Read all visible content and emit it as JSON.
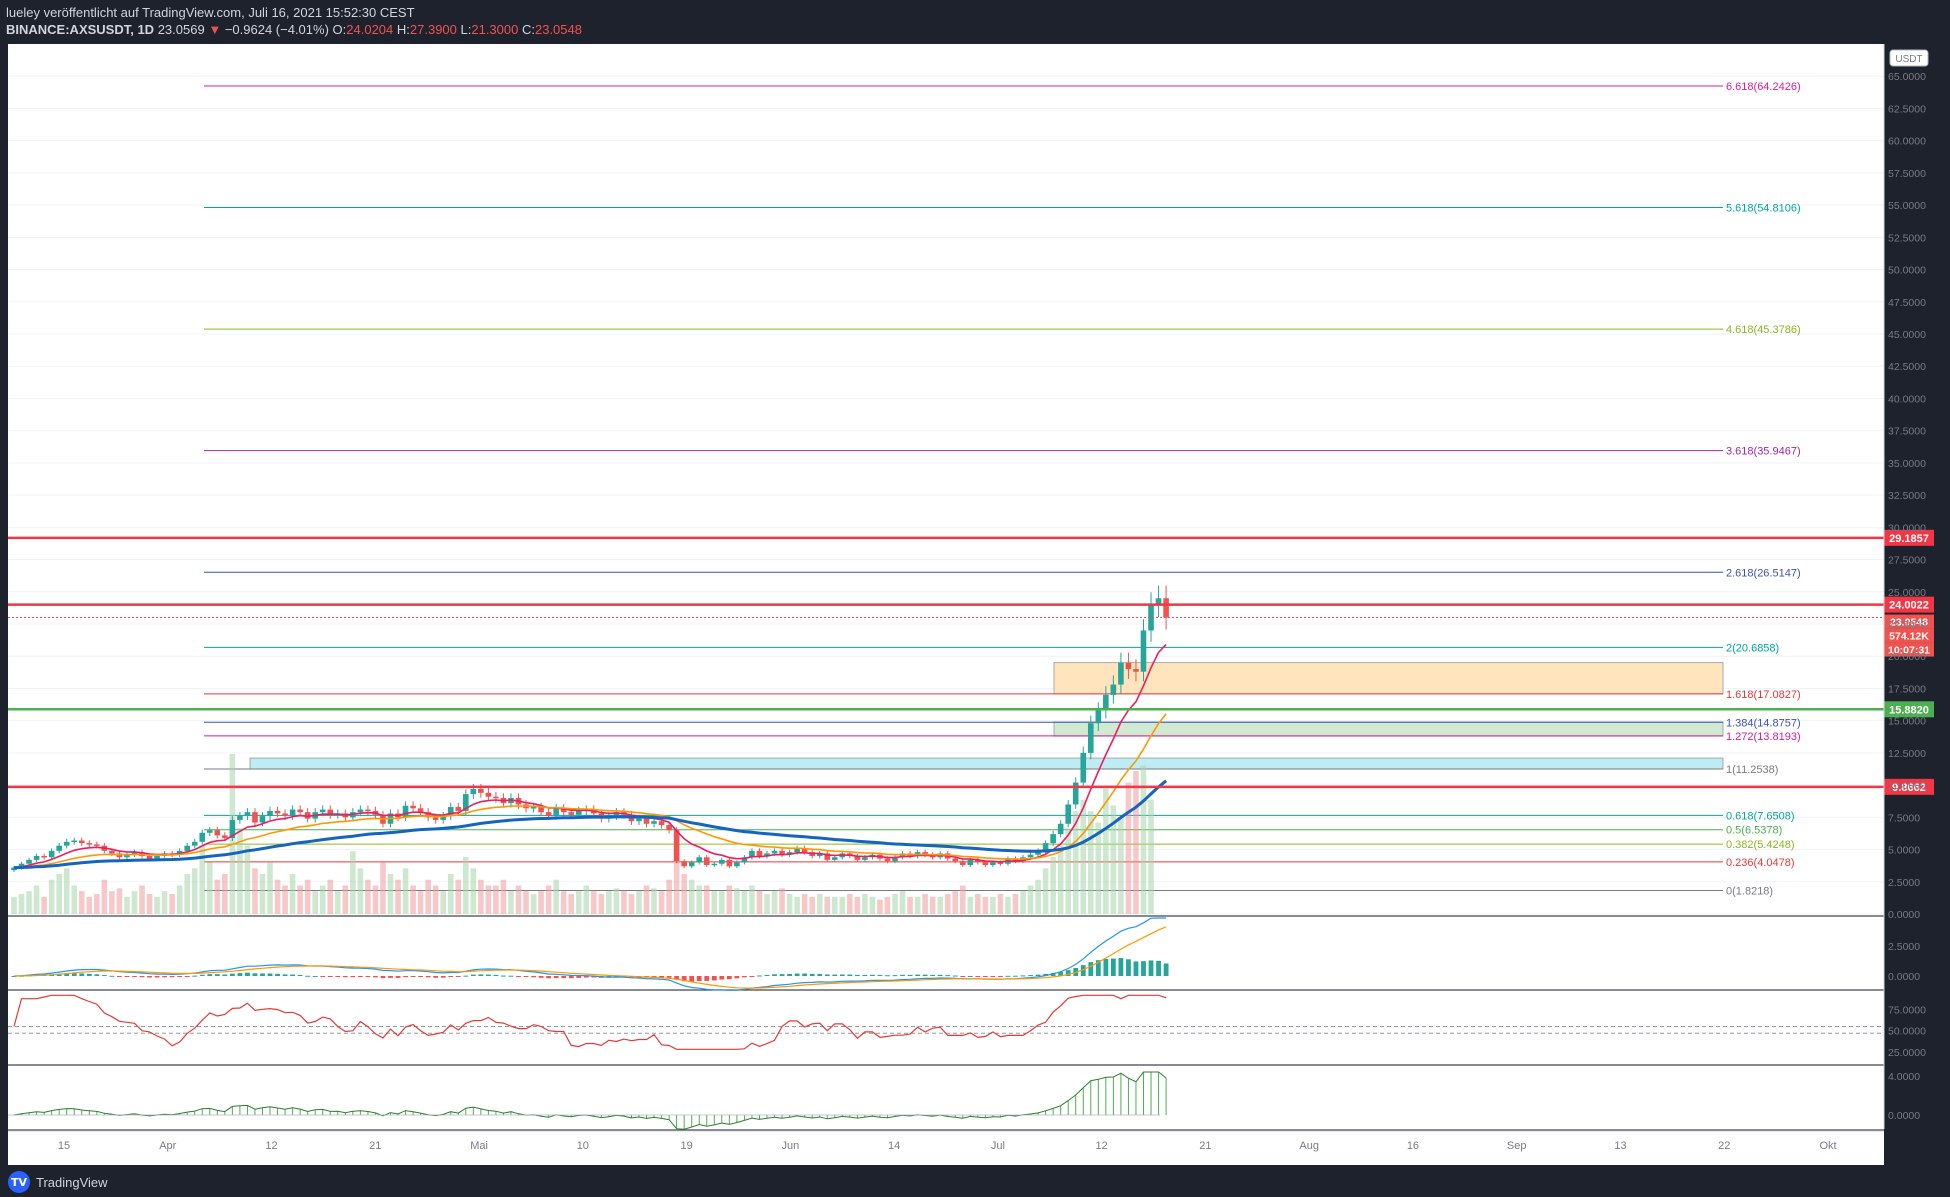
{
  "header": {
    "publisher": "lueley veröffentlicht auf TradingView.com, Juli 16, 2021 15:52:30 CEST",
    "symbol": "BINANCE:AXSUSDT, 1D",
    "last": "23.0569",
    "change": "−0.9624 (−4.01%)",
    "o_label": "O:",
    "o_value": "24.0204",
    "h_label": "H:",
    "h_value": "27.3900",
    "l_label": "L:",
    "l_value": "21.3000",
    "c_label": "C:",
    "c_value": "23.0548"
  },
  "footer": {
    "brand": "TradingView",
    "logo_text": "TV"
  },
  "colors": {
    "background": "#ffffff",
    "up": "#26a69a",
    "down": "#ef5350",
    "resistance": "#f23645",
    "support": "#4caf50"
  },
  "chart_data": {
    "type": "line",
    "price_unit_badge": "USDT",
    "x_tick_labels": [
      "15",
      "Apr",
      "12",
      "21",
      "Mai",
      "10",
      "19",
      "Jun",
      "14",
      "Jul",
      "12",
      "21",
      "Aug",
      "16",
      "Sep",
      "13",
      "22",
      "Okt"
    ],
    "y_ticks": [
      "65.0000",
      "62.5000",
      "60.0000",
      "57.5000",
      "55.0000",
      "52.5000",
      "50.0000",
      "47.5000",
      "45.0000",
      "42.5000",
      "40.0000",
      "37.5000",
      "35.0000",
      "32.5000",
      "30.0000",
      "27.5000",
      "25.0000",
      "22.5000",
      "20.0000",
      "17.5000",
      "15.0000",
      "12.5000",
      "10.0000",
      "7.5000",
      "5.0000",
      "2.5000",
      "0.0000"
    ],
    "ylim": [
      0,
      67.5
    ],
    "fib_levels": [
      {
        "label": "6.618(64.2426)",
        "value": 64.2426,
        "color": "#d81b9c"
      },
      {
        "label": "5.618(54.8106)",
        "value": 54.8106,
        "color": "#00a79d"
      },
      {
        "label": "4.618(45.3786)",
        "value": 45.3786,
        "color": "#8bb71e"
      },
      {
        "label": "3.618(35.9467)",
        "value": 35.9467,
        "color": "#9c27b0"
      },
      {
        "label": "2.618(26.5147)",
        "value": 26.5147,
        "color": "#3f51b5"
      },
      {
        "label": "2(20.6858)",
        "value": 20.6858,
        "color": "#00a79d"
      },
      {
        "label": "1.618(17.0827)",
        "value": 17.0827,
        "color": "#e53935"
      },
      {
        "label": "1.384(14.8757)",
        "value": 14.8757,
        "color": "#3f51b5"
      },
      {
        "label": "1.272(13.8193)",
        "value": 13.8193,
        "color": "#d81b9c"
      },
      {
        "label": "1(11.2538)",
        "value": 11.2538,
        "color": "#787b86"
      },
      {
        "label": "0.618(7.6508)",
        "value": 7.6508,
        "color": "#00a79d"
      },
      {
        "label": "0.5(6.5378)",
        "value": 6.5378,
        "color": "#4caf50"
      },
      {
        "label": "0.382(5.4248)",
        "value": 5.4248,
        "color": "#8bb71e"
      },
      {
        "label": "0.236(4.0478)",
        "value": 4.0478,
        "color": "#e53935"
      },
      {
        "label": "0(1.8218)",
        "value": 1.8218,
        "color": "#787b86"
      }
    ],
    "horizontal_lines": [
      {
        "label": "29.1857",
        "value": 29.1857,
        "color": "#f23645"
      },
      {
        "label": "24.0022",
        "value": 24.0022,
        "color": "#f23645"
      },
      {
        "label": "15.8820",
        "value": 15.882,
        "color": "#4caf50"
      },
      {
        "label": "9.8662",
        "value": 9.8662,
        "color": "#f23645"
      }
    ],
    "price_tags": [
      {
        "text": "23.0548",
        "color": "#ef5350"
      },
      {
        "text": "574.12K",
        "color": "#ef5350"
      },
      {
        "text": "10:07:31",
        "color": "#ef5350"
      }
    ],
    "zones": [
      {
        "from": 17.08,
        "to": 19.5,
        "color": "#ffe0b2"
      },
      {
        "from": 13.8,
        "to": 14.9,
        "color": "#c8e6c9"
      },
      {
        "from": 11.25,
        "to": 12.1,
        "color": "#b2ebf2"
      }
    ],
    "closes": [
      3.6,
      3.9,
      4.2,
      4.5,
      4.4,
      4.9,
      5.3,
      5.6,
      5.7,
      5.5,
      5.4,
      5.3,
      4.9,
      4.7,
      4.4,
      4.6,
      4.8,
      4.5,
      4.3,
      4.5,
      4.7,
      4.6,
      4.9,
      5.3,
      5.6,
      6.3,
      6.5,
      6.1,
      5.9,
      7.3,
      7.6,
      7.9,
      7.1,
      7.6,
      8.0,
      7.8,
      7.6,
      8.1,
      7.9,
      7.4,
      7.9,
      8.1,
      7.7,
      7.8,
      7.5,
      7.9,
      8.1,
      8.0,
      7.7,
      7.0,
      7.8,
      7.5,
      8.4,
      8.2,
      7.9,
      7.5,
      7.3,
      7.6,
      8.3,
      8.0,
      9.3,
      9.7,
      9.4,
      9.1,
      9.0,
      8.6,
      9.0,
      8.5,
      8.2,
      8.3,
      7.9,
      7.6,
      8.2,
      7.9,
      7.7,
      8.0,
      8.1,
      7.8,
      7.4,
      7.6,
      7.9,
      7.7,
      7.2,
      7.4,
      7.0,
      7.2,
      6.9,
      6.5,
      4.1,
      3.7,
      4.0,
      4.4,
      3.8,
      3.9,
      4.2,
      3.7,
      4.0,
      4.4,
      4.9,
      4.5,
      4.7,
      4.9,
      4.6,
      4.8,
      5.1,
      4.8,
      4.5,
      4.7,
      4.2,
      4.4,
      4.7,
      4.5,
      4.2,
      4.4,
      4.6,
      4.3,
      4.1,
      4.4,
      4.7,
      4.5,
      4.8,
      4.6,
      4.4,
      4.7,
      4.3,
      4.1,
      3.8,
      4.2,
      4.0,
      3.8,
      4.0,
      3.9,
      4.3,
      4.1,
      4.4,
      4.6,
      4.9,
      5.5,
      6.2,
      7.0,
      8.5,
      10.2,
      12.5,
      14.8,
      15.8,
      17.0,
      17.8,
      19.5,
      19.0,
      18.8,
      22.0,
      24.0,
      24.5,
      23.0
    ],
    "volumes": [
      0.3,
      0.35,
      0.4,
      0.5,
      0.3,
      0.6,
      0.7,
      0.8,
      0.5,
      0.4,
      0.3,
      0.35,
      0.6,
      0.4,
      0.45,
      0.3,
      0.4,
      0.5,
      0.35,
      0.3,
      0.4,
      0.35,
      0.5,
      0.7,
      0.8,
      1.2,
      0.9,
      0.6,
      0.7,
      2.8,
      1.5,
      1.2,
      0.8,
      0.7,
      0.9,
      0.6,
      0.5,
      0.7,
      0.5,
      0.6,
      0.4,
      0.5,
      0.6,
      0.4,
      0.5,
      1.1,
      0.8,
      0.6,
      0.5,
      0.9,
      0.7,
      0.6,
      0.8,
      0.5,
      0.4,
      0.6,
      0.5,
      0.4,
      0.7,
      0.6,
      1.0,
      0.8,
      0.6,
      0.5,
      0.5,
      0.6,
      0.4,
      0.5,
      0.4,
      0.35,
      0.4,
      0.5,
      0.6,
      0.4,
      0.35,
      0.4,
      0.5,
      0.4,
      0.35,
      0.4,
      0.45,
      0.4,
      0.35,
      0.4,
      0.5,
      0.45,
      0.4,
      0.6,
      1.1,
      0.7,
      0.6,
      0.5,
      0.5,
      0.4,
      0.4,
      0.5,
      0.45,
      0.4,
      0.5,
      0.4,
      0.35,
      0.4,
      0.45,
      0.35,
      0.3,
      0.35,
      0.3,
      0.35,
      0.3,
      0.3,
      0.3,
      0.35,
      0.3,
      0.35,
      0.3,
      0.25,
      0.3,
      0.35,
      0.4,
      0.3,
      0.3,
      0.35,
      0.3,
      0.3,
      0.35,
      0.4,
      0.5,
      0.3,
      0.35,
      0.3,
      0.3,
      0.35,
      0.3,
      0.35,
      0.4,
      0.5,
      0.6,
      0.8,
      1.0,
      1.2,
      1.5,
      1.8,
      2.0,
      1.8,
      1.6,
      2.2,
      1.9,
      1.7,
      2.3,
      2.5,
      2.6,
      2.0
    ],
    "macd_ticks": [
      "2.5000",
      "0.0000"
    ],
    "rsi_ticks": [
      "75.0000",
      "50.0000",
      "25.0000"
    ],
    "osc_ticks": [
      "4.0000",
      "0.0000"
    ]
  }
}
